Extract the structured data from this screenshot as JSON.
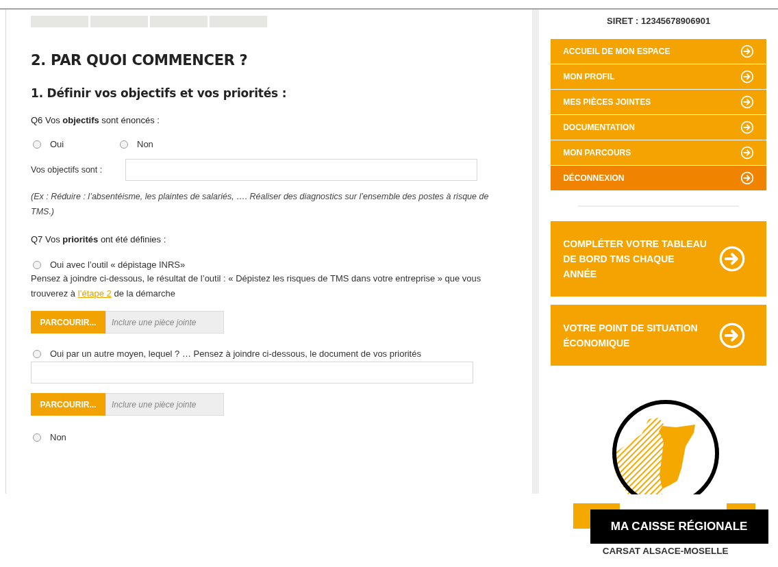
{
  "main": {
    "heading": "2. PAR QUOI COMMENCER ?",
    "subheading": "1. Définir vos objectifs et vos priorités :",
    "questions": [
      {
        "label": "Q6 Vos **objectifs** sont énoncés :",
        "items": [
          {
            "kind": "radio_row",
            "options": [
              {
                "label": "Oui",
                "selected": false
              },
              {
                "label": "Non",
                "selected": false
              }
            ]
          },
          {
            "kind": "text_field",
            "label": "Vos objectifs sont :"
          },
          {
            "kind": "note",
            "text": "(Ex : Réduire : l’absentéisme, les plaintes de salariés, …. Réaliser des diagnostics sur l’ensemble des postes à risque de TMS.)"
          }
        ]
      },
      {
        "label": "Q7 Vos **priorités** ont été définies :",
        "items": [
          {
            "kind": "radio",
            "label": "Oui avec l’outil « dépistage INRS»",
            "selected": false
          },
          {
            "kind": "paragraph",
            "text": "Pensez à joindre ci-dessous, le résultat de l’outil : « Dépistez les risques de TMS dans votre entreprise » que vous trouverez à ",
            "link": "l’étape 2",
            "after": " de la démarche"
          },
          {
            "kind": "file",
            "button": "PARCOURIR...",
            "placeholder": "Inclure une pièce jointe"
          },
          {
            "kind": "radio",
            "label": "Oui par un autre moyen, lequel ? … Pensez à joindre ci-dessous, le document de vos priorités",
            "selected": false
          },
          {
            "kind": "text_field"
          },
          {
            "kind": "file",
            "button": "PARCOURIR...",
            "placeholder": "Inclure une pièce jointe"
          },
          {
            "kind": "radio",
            "label": "Non",
            "selected": false
          }
        ]
      }
    ]
  },
  "sidebar": {
    "siret": "SIRET : 12345678906901",
    "menu": [
      {
        "label": "ACCUEIL DE MON ESPACE",
        "kind": "link"
      },
      {
        "label": "MON PROFIL",
        "kind": "link"
      },
      {
        "label": "MES PIÈCES JOINTES",
        "kind": "link"
      },
      {
        "label": "DOCUMENTATION",
        "kind": "link"
      },
      {
        "label": "MON PARCOURS",
        "kind": "link"
      },
      {
        "label": "DÉCONNEXION",
        "kind": "logout"
      }
    ],
    "cards": [
      "COMPLÉTER VOTRE TABLEAU DE BORD TMS CHAQUE ANNÉE",
      "VOTRE POINT DE SITUATION ÉCONOMIQUE"
    ],
    "region": {
      "banner": "MA CAISSE RÉGIONALE",
      "caption": "CARSAT ALSACE-MOSELLE"
    }
  }
}
